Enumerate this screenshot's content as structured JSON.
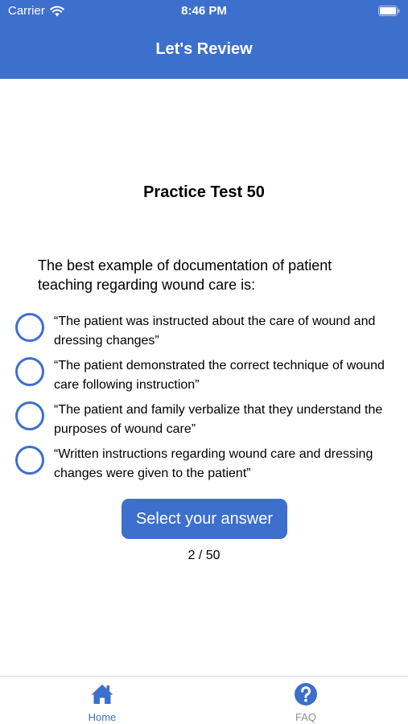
{
  "status_bar": {
    "carrier": "Carrier",
    "time": "8:46 PM"
  },
  "header": {
    "title": "Let's Review"
  },
  "test": {
    "title": "Practice Test 50",
    "question": "The best example of documentation of patient teaching regarding wound care is:",
    "options": [
      {
        "text": "“The patient was instructed about the care of wound and dressing changes”"
      },
      {
        "text": "“The patient demonstrated the correct technique of wound care following instruction”"
      },
      {
        "text": "“The patient and family verbalize that they understand the purposes of wound care”"
      },
      {
        "text": "“Written instructions regarding wound care and dressing changes were given to the patient”"
      }
    ],
    "button_label": "Select your answer",
    "progress": "2 / 50"
  },
  "tab_bar": {
    "home_label": "Home",
    "faq_label": "FAQ"
  },
  "colors": {
    "accent": "#3d6fcc",
    "inactive": "#8e8e93"
  }
}
